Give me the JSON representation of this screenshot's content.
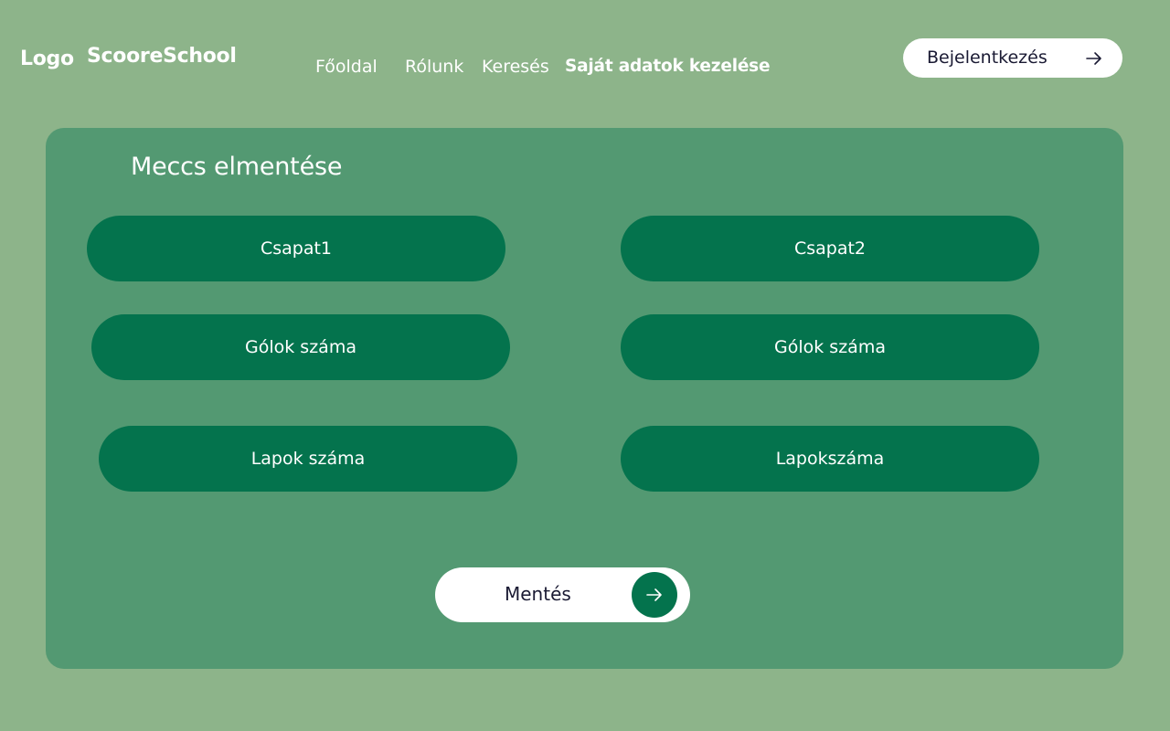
{
  "header": {
    "logo": "Logo",
    "brand": "ScooreSchool",
    "nav": {
      "home": "Főoldal",
      "about": "Rólunk",
      "search": "Keresés",
      "own_data": "Saját adatok kezelése"
    },
    "login_label": "Bejelentkezés",
    "login_icon": "arrow-right-icon"
  },
  "form": {
    "title": "Meccs elmentése",
    "fields": {
      "team1": "Csapat1",
      "team2": "Csapat2",
      "goals1": "Gólok száma",
      "goals2": "Gólok száma",
      "cards1": "Lapok száma",
      "cards2": "Lapokszáma"
    },
    "save_label": "Mentés",
    "save_icon": "arrow-right-icon"
  },
  "colors": {
    "page_background": "#8db48a",
    "panel_background": "#539972",
    "field_background": "#04734d",
    "button_background": "#ffffff",
    "button_text": "#1a1a33"
  }
}
